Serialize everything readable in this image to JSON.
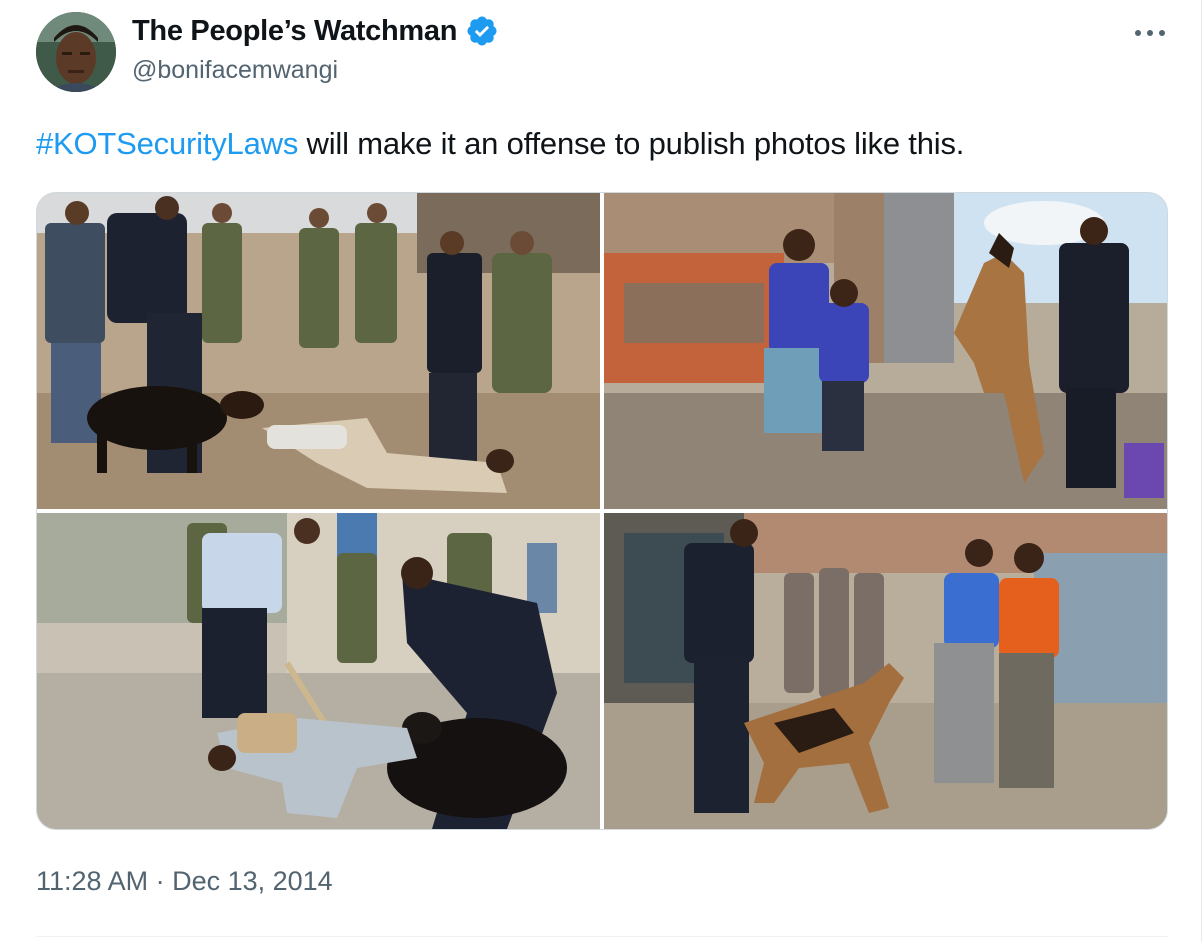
{
  "author": {
    "display_name": "The People’s Watchman",
    "handle": "@bonifacemwangi",
    "verified": true
  },
  "tweet": {
    "hashtag": "#KOTSecurityLaws",
    "text": " will make it an offense to publish photos like this.",
    "timestamp": "11:28 AM · Dec 13, 2014"
  },
  "media": [
    {
      "icon": "photo-police-dog-attack-ground"
    },
    {
      "icon": "photo-dog-lunging-at-schoolchildren"
    },
    {
      "icon": "photo-officer-beating-man-with-stick"
    },
    {
      "icon": "photo-dog-chasing-youths"
    }
  ],
  "colors": {
    "accent": "#1d9bf0",
    "secondary_text": "#536471",
    "border": "#cfd9de"
  }
}
